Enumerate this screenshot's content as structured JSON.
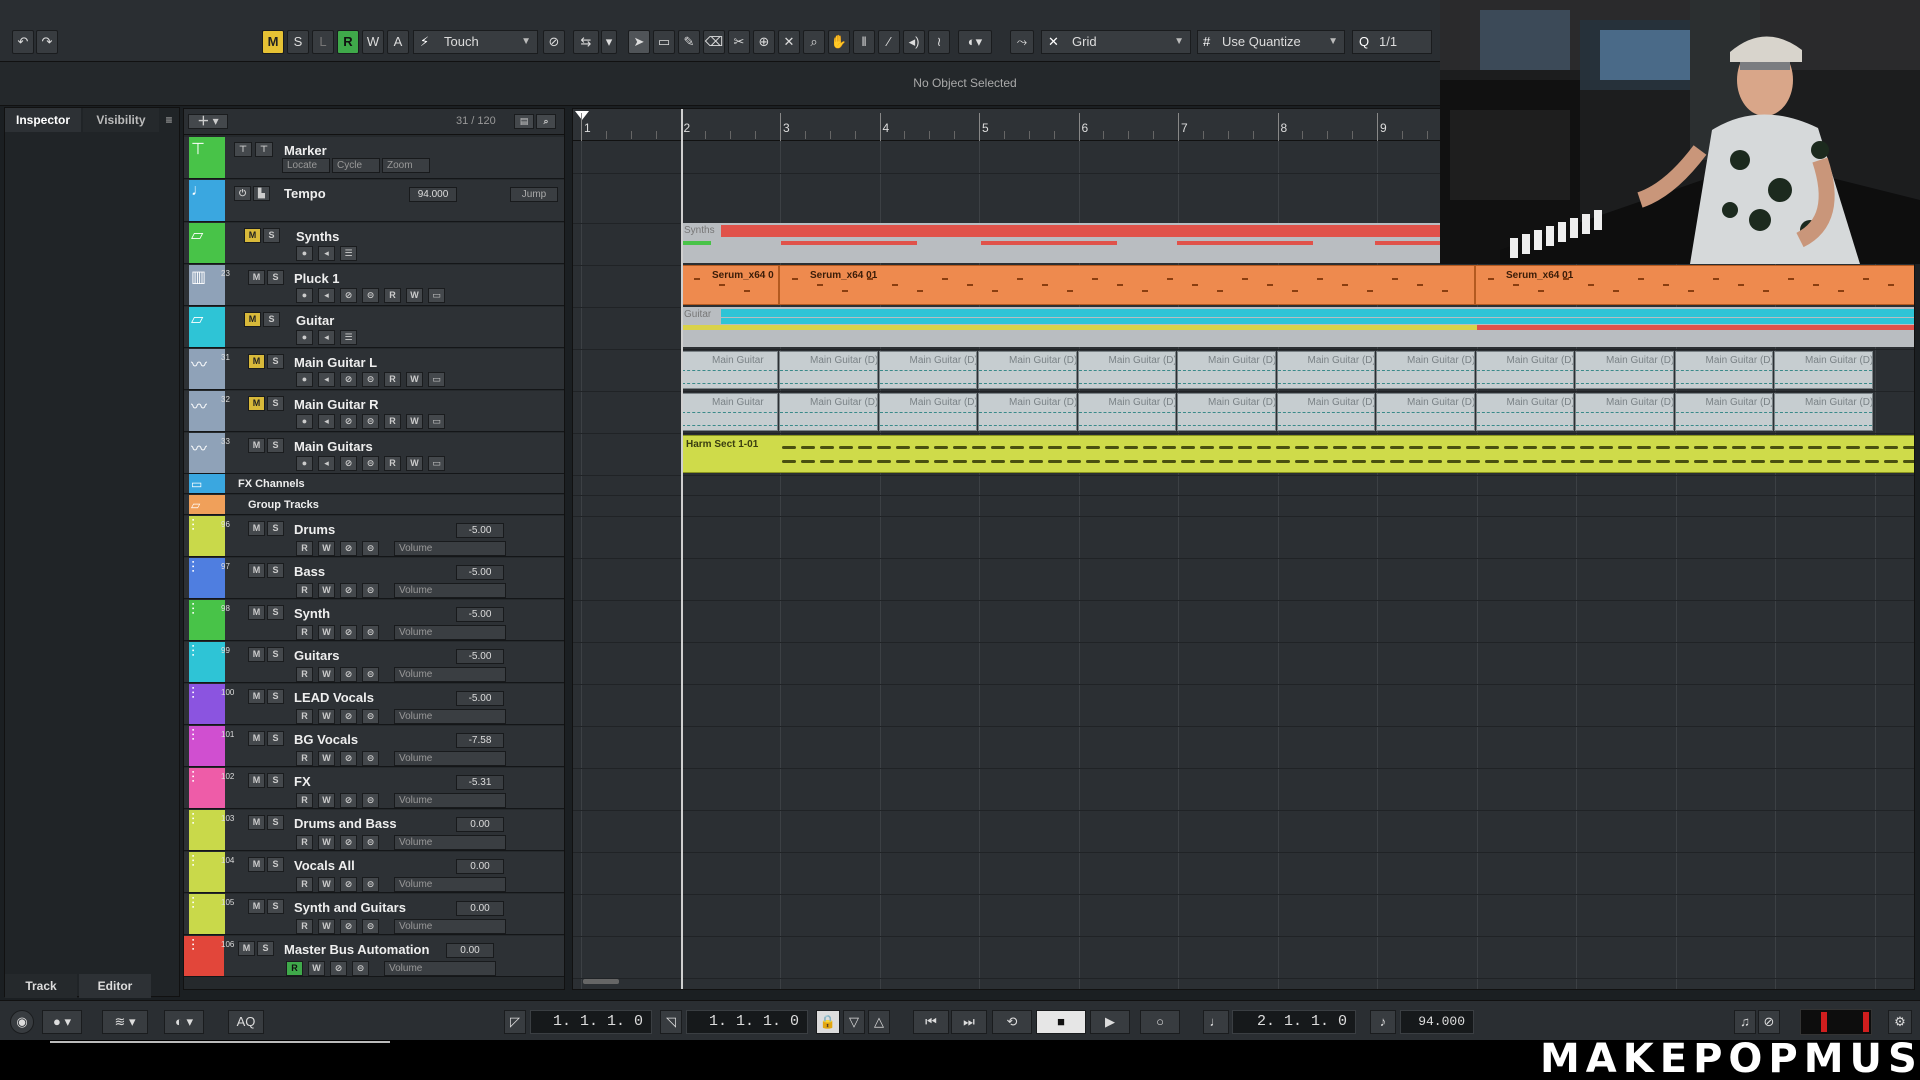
{
  "toolbar": {
    "mode_buttons": [
      "M",
      "S",
      "L",
      "R",
      "W",
      "A"
    ],
    "automation_mode": "Touch",
    "snap_type": "Grid",
    "quantize": "Use Quantize",
    "quantize_value": "1/1"
  },
  "infoline": {
    "text": "No Object Selected"
  },
  "inspector": {
    "tabs": [
      "Inspector",
      "Visibility"
    ],
    "bottom_tabs": [
      "Track",
      "Editor"
    ]
  },
  "tracklist": {
    "count": "31 / 120"
  },
  "marker_track": {
    "name": "Marker",
    "buttons": [
      "Locate",
      "Cycle",
      "Zoom"
    ]
  },
  "tempo_track": {
    "name": "Tempo",
    "value": "94.000",
    "mode": "Jump"
  },
  "tracks": [
    {
      "name": "Synths",
      "num": "",
      "color": "#48c348",
      "type": "folder"
    },
    {
      "name": "Pluck 1",
      "num": "23",
      "color": "#8fa2b8",
      "type": "instrument"
    },
    {
      "name": "Guitar",
      "num": "",
      "color": "#2ec4d6",
      "type": "folder"
    },
    {
      "name": "Main Guitar L",
      "num": "31",
      "color": "#8fa2b8",
      "type": "audio"
    },
    {
      "name": "Main Guitar R",
      "num": "32",
      "color": "#8fa2b8",
      "type": "audio"
    },
    {
      "name": "Main Guitars",
      "num": "33",
      "color": "#8fa2b8",
      "type": "audio"
    }
  ],
  "folders": [
    {
      "name": "FX Channels"
    },
    {
      "name": "Group Tracks"
    }
  ],
  "groups": [
    {
      "name": "Drums",
      "num": "96",
      "value": "-5.00",
      "color": "#c9d94a"
    },
    {
      "name": "Bass",
      "num": "97",
      "value": "-5.00",
      "color": "#4f7ee0"
    },
    {
      "name": "Synth",
      "num": "98",
      "value": "-5.00",
      "color": "#48c348"
    },
    {
      "name": "Guitars",
      "num": "99",
      "value": "-5.00",
      "color": "#2ec4d6"
    },
    {
      "name": "LEAD Vocals",
      "num": "100",
      "value": "-5.00",
      "color": "#8b54e0"
    },
    {
      "name": "BG Vocals",
      "num": "101",
      "value": "-7.58",
      "color": "#d04fd0"
    },
    {
      "name": "FX",
      "num": "102",
      "value": "-5.31",
      "color": "#ee5ca8"
    },
    {
      "name": "Drums and Bass",
      "num": "103",
      "value": "0.00",
      "color": "#c9d94a"
    },
    {
      "name": "Vocals All",
      "num": "104",
      "value": "0.00",
      "color": "#c9d94a"
    },
    {
      "name": "Synth and Guitars",
      "num": "105",
      "value": "0.00",
      "color": "#c9d94a"
    },
    {
      "name": "Master Bus Automation",
      "num": "106",
      "value": "0.00",
      "color": "#e2463a"
    }
  ],
  "group_sub_label": "Volume",
  "ruler": {
    "bars": [
      "1",
      "2",
      "3",
      "4",
      "5",
      "6",
      "7",
      "8",
      "9"
    ]
  },
  "clips": {
    "synths_folder": "Synths",
    "serum": [
      "Serum_x64 0",
      "Serum_x64 01",
      "Serum_x64 01"
    ],
    "guitar_folder": "Guitar",
    "main_guitar": [
      "Main Guitar",
      "Main Guitar (D)_0",
      "Main Guitar (D)_0",
      "Main Guitar (D)_0",
      "Main Guitar (D)_0",
      "Main Guitar (D)_0",
      "Main Guitar (D)_1",
      "Main Guitar (D)_0",
      "Main Guitar (D)_0",
      "Main Guitar (D)_0",
      "Main Guitar (D)_0",
      "Main Guitar (D)_0"
    ],
    "harm": "Harm Sect 1-01"
  },
  "transport": {
    "left_locator": "1. 1. 1.  0",
    "right_locator": "1. 1. 1.  0",
    "position": "2. 1. 1.  0",
    "tempo": "94.000",
    "aq": "AQ"
  },
  "brand": "MAKEPOPMUSIC"
}
